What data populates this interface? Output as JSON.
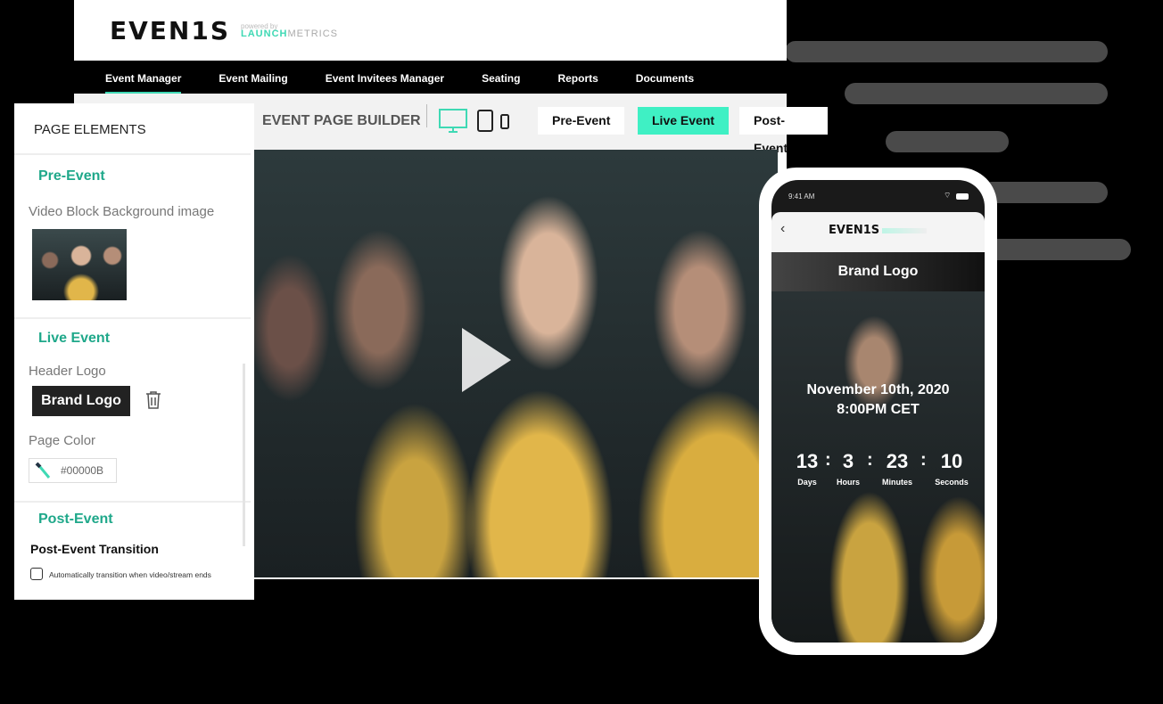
{
  "brand": {
    "logo": "EVEN1S",
    "powered": "powered by",
    "launch": "LAUNCH",
    "metrics": "METRICS",
    "accent": "#3fd9b4"
  },
  "nav": {
    "items": [
      "Event Manager",
      "Event Mailing",
      "Event Invitees Manager",
      "Seating",
      "Reports",
      "Documents"
    ],
    "active": "Event Manager"
  },
  "builder": {
    "title": "EVENT PAGE BUILDER",
    "devices": [
      "desktop-icon",
      "tablet-icon",
      "mobile-icon"
    ],
    "phases": [
      "Pre-Event",
      "Live Event",
      "Post- Event"
    ],
    "active_phase": "Live Event"
  },
  "panel": {
    "title": "PAGE ELEMENTS",
    "pre_event": "Pre-Event",
    "video_bg_label": "Video Block Background image",
    "live_event": "Live Event",
    "header_logo_label": "Header Logo",
    "brand_logo": "Brand Logo",
    "page_color_label": "Page Color",
    "page_color": "#00000B",
    "post_event": "Post-Event",
    "transition_title": "Post-Event Transition",
    "transition_checkbox": "Automatically transition when video/stream ends"
  },
  "phone": {
    "time": "9:41 AM",
    "logo": "EVEN1S",
    "brand_logo": "Brand Logo",
    "date": "November 10th, 2020",
    "time_cet": "8:00PM CET",
    "countdown": [
      {
        "value": "13",
        "unit": "Days"
      },
      {
        "value": "3",
        "unit": "Hours"
      },
      {
        "value": "23",
        "unit": "Minutes"
      },
      {
        "value": "10",
        "unit": "Seconds"
      }
    ]
  }
}
